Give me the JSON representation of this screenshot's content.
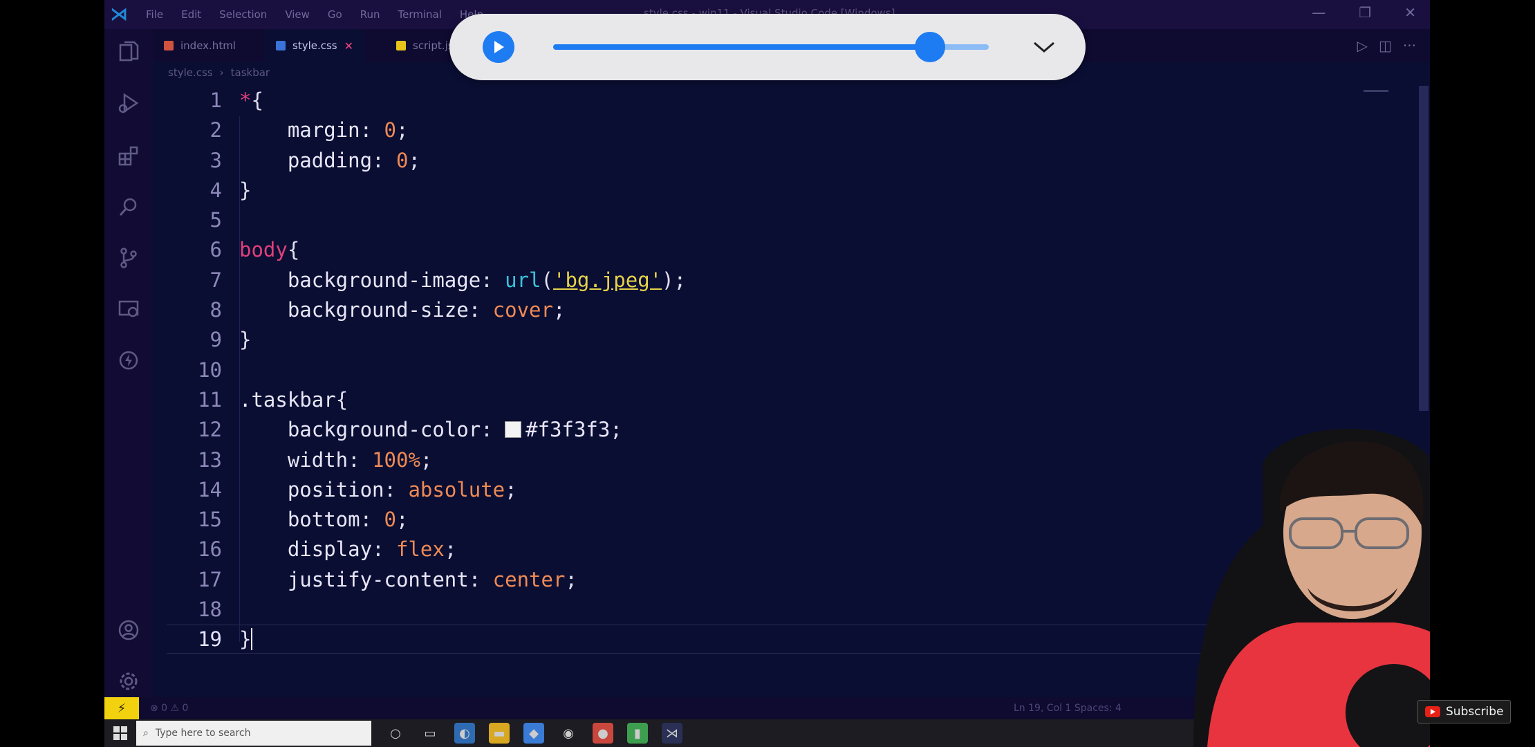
{
  "titlebar": {
    "menu": [
      "File",
      "Edit",
      "Selection",
      "View",
      "Go",
      "Run",
      "Terminal",
      "Help"
    ],
    "window_title": "style.css - win11 - Visual Studio Code [Windows]"
  },
  "tabs": [
    {
      "label": "index.html",
      "icon": "html-file-icon"
    },
    {
      "label": "style.css",
      "icon": "css-file-icon",
      "active": true
    },
    {
      "label": "script.js",
      "icon": "js-file-icon"
    }
  ],
  "breadcrumb": {
    "file": "style.css",
    "symbol": "taskbar"
  },
  "code": {
    "line_numbers": [
      "1",
      "2",
      "3",
      "4",
      "5",
      "6",
      "7",
      "8",
      "9",
      "10",
      "11",
      "12",
      "13",
      "14",
      "15",
      "16",
      "17",
      "18",
      "19"
    ],
    "current_line": "19",
    "lines": [
      [
        {
          "t": "*",
          "c": "star"
        },
        {
          "t": "{",
          "c": "punct"
        }
      ],
      [
        {
          "t": "    margin",
          "c": "prop"
        },
        {
          "t": ": ",
          "c": "punct"
        },
        {
          "t": "0",
          "c": "num"
        },
        {
          "t": ";",
          "c": "punct"
        }
      ],
      [
        {
          "t": "    padding",
          "c": "prop"
        },
        {
          "t": ": ",
          "c": "punct"
        },
        {
          "t": "0",
          "c": "num"
        },
        {
          "t": ";",
          "c": "punct"
        }
      ],
      [
        {
          "t": "}",
          "c": "punct"
        }
      ],
      [],
      [
        {
          "t": "body",
          "c": "sel-el"
        },
        {
          "t": "{",
          "c": "punct"
        }
      ],
      [
        {
          "t": "    background-image",
          "c": "prop"
        },
        {
          "t": ": ",
          "c": "punct"
        },
        {
          "t": "url",
          "c": "fn"
        },
        {
          "t": "(",
          "c": "punct"
        },
        {
          "t": "'bg.jpeg'",
          "c": "str"
        },
        {
          "t": ");",
          "c": "punct"
        }
      ],
      [
        {
          "t": "    background-size",
          "c": "prop"
        },
        {
          "t": ": ",
          "c": "punct"
        },
        {
          "t": "cover",
          "c": "kw"
        },
        {
          "t": ";",
          "c": "punct"
        }
      ],
      [
        {
          "t": "}",
          "c": "punct"
        }
      ],
      [],
      [
        {
          "t": ".taskbar",
          "c": "sel-class"
        },
        {
          "t": "{",
          "c": "punct"
        }
      ],
      [
        {
          "t": "    background-color",
          "c": "prop"
        },
        {
          "t": ": ",
          "c": "punct"
        },
        {
          "t": "",
          "c": "swatch"
        },
        {
          "t": "#f3f3f3",
          "c": "prop"
        },
        {
          "t": ";",
          "c": "punct"
        }
      ],
      [
        {
          "t": "    width",
          "c": "prop"
        },
        {
          "t": ": ",
          "c": "punct"
        },
        {
          "t": "100%",
          "c": "num"
        },
        {
          "t": ";",
          "c": "punct"
        }
      ],
      [
        {
          "t": "    position",
          "c": "prop"
        },
        {
          "t": ": ",
          "c": "punct"
        },
        {
          "t": "absolute",
          "c": "kw"
        },
        {
          "t": ";",
          "c": "punct"
        }
      ],
      [
        {
          "t": "    bottom",
          "c": "prop"
        },
        {
          "t": ": ",
          "c": "punct"
        },
        {
          "t": "0",
          "c": "num"
        },
        {
          "t": ";",
          "c": "punct"
        }
      ],
      [
        {
          "t": "    display",
          "c": "prop"
        },
        {
          "t": ": ",
          "c": "punct"
        },
        {
          "t": "flex",
          "c": "kw"
        },
        {
          "t": ";",
          "c": "punct"
        }
      ],
      [
        {
          "t": "    justify-content",
          "c": "prop"
        },
        {
          "t": ": ",
          "c": "punct"
        },
        {
          "t": "center",
          "c": "kw"
        },
        {
          "t": ";",
          "c": "punct"
        }
      ],
      [],
      [
        {
          "t": "}",
          "c": "punct"
        },
        {
          "t": "",
          "c": "cursor"
        }
      ]
    ]
  },
  "statusbar": {
    "problems": "⊗ 0 ⚠ 0",
    "position": "Ln 19, Col 1   Spaces: 4"
  },
  "taskbar": {
    "search_placeholder": "Type here to search"
  },
  "media": {
    "progress": 0.865,
    "collapse_icon": "chevron-down-icon",
    "accent": "#1e7cf2"
  },
  "subscribe": {
    "label": "Subscribe"
  }
}
